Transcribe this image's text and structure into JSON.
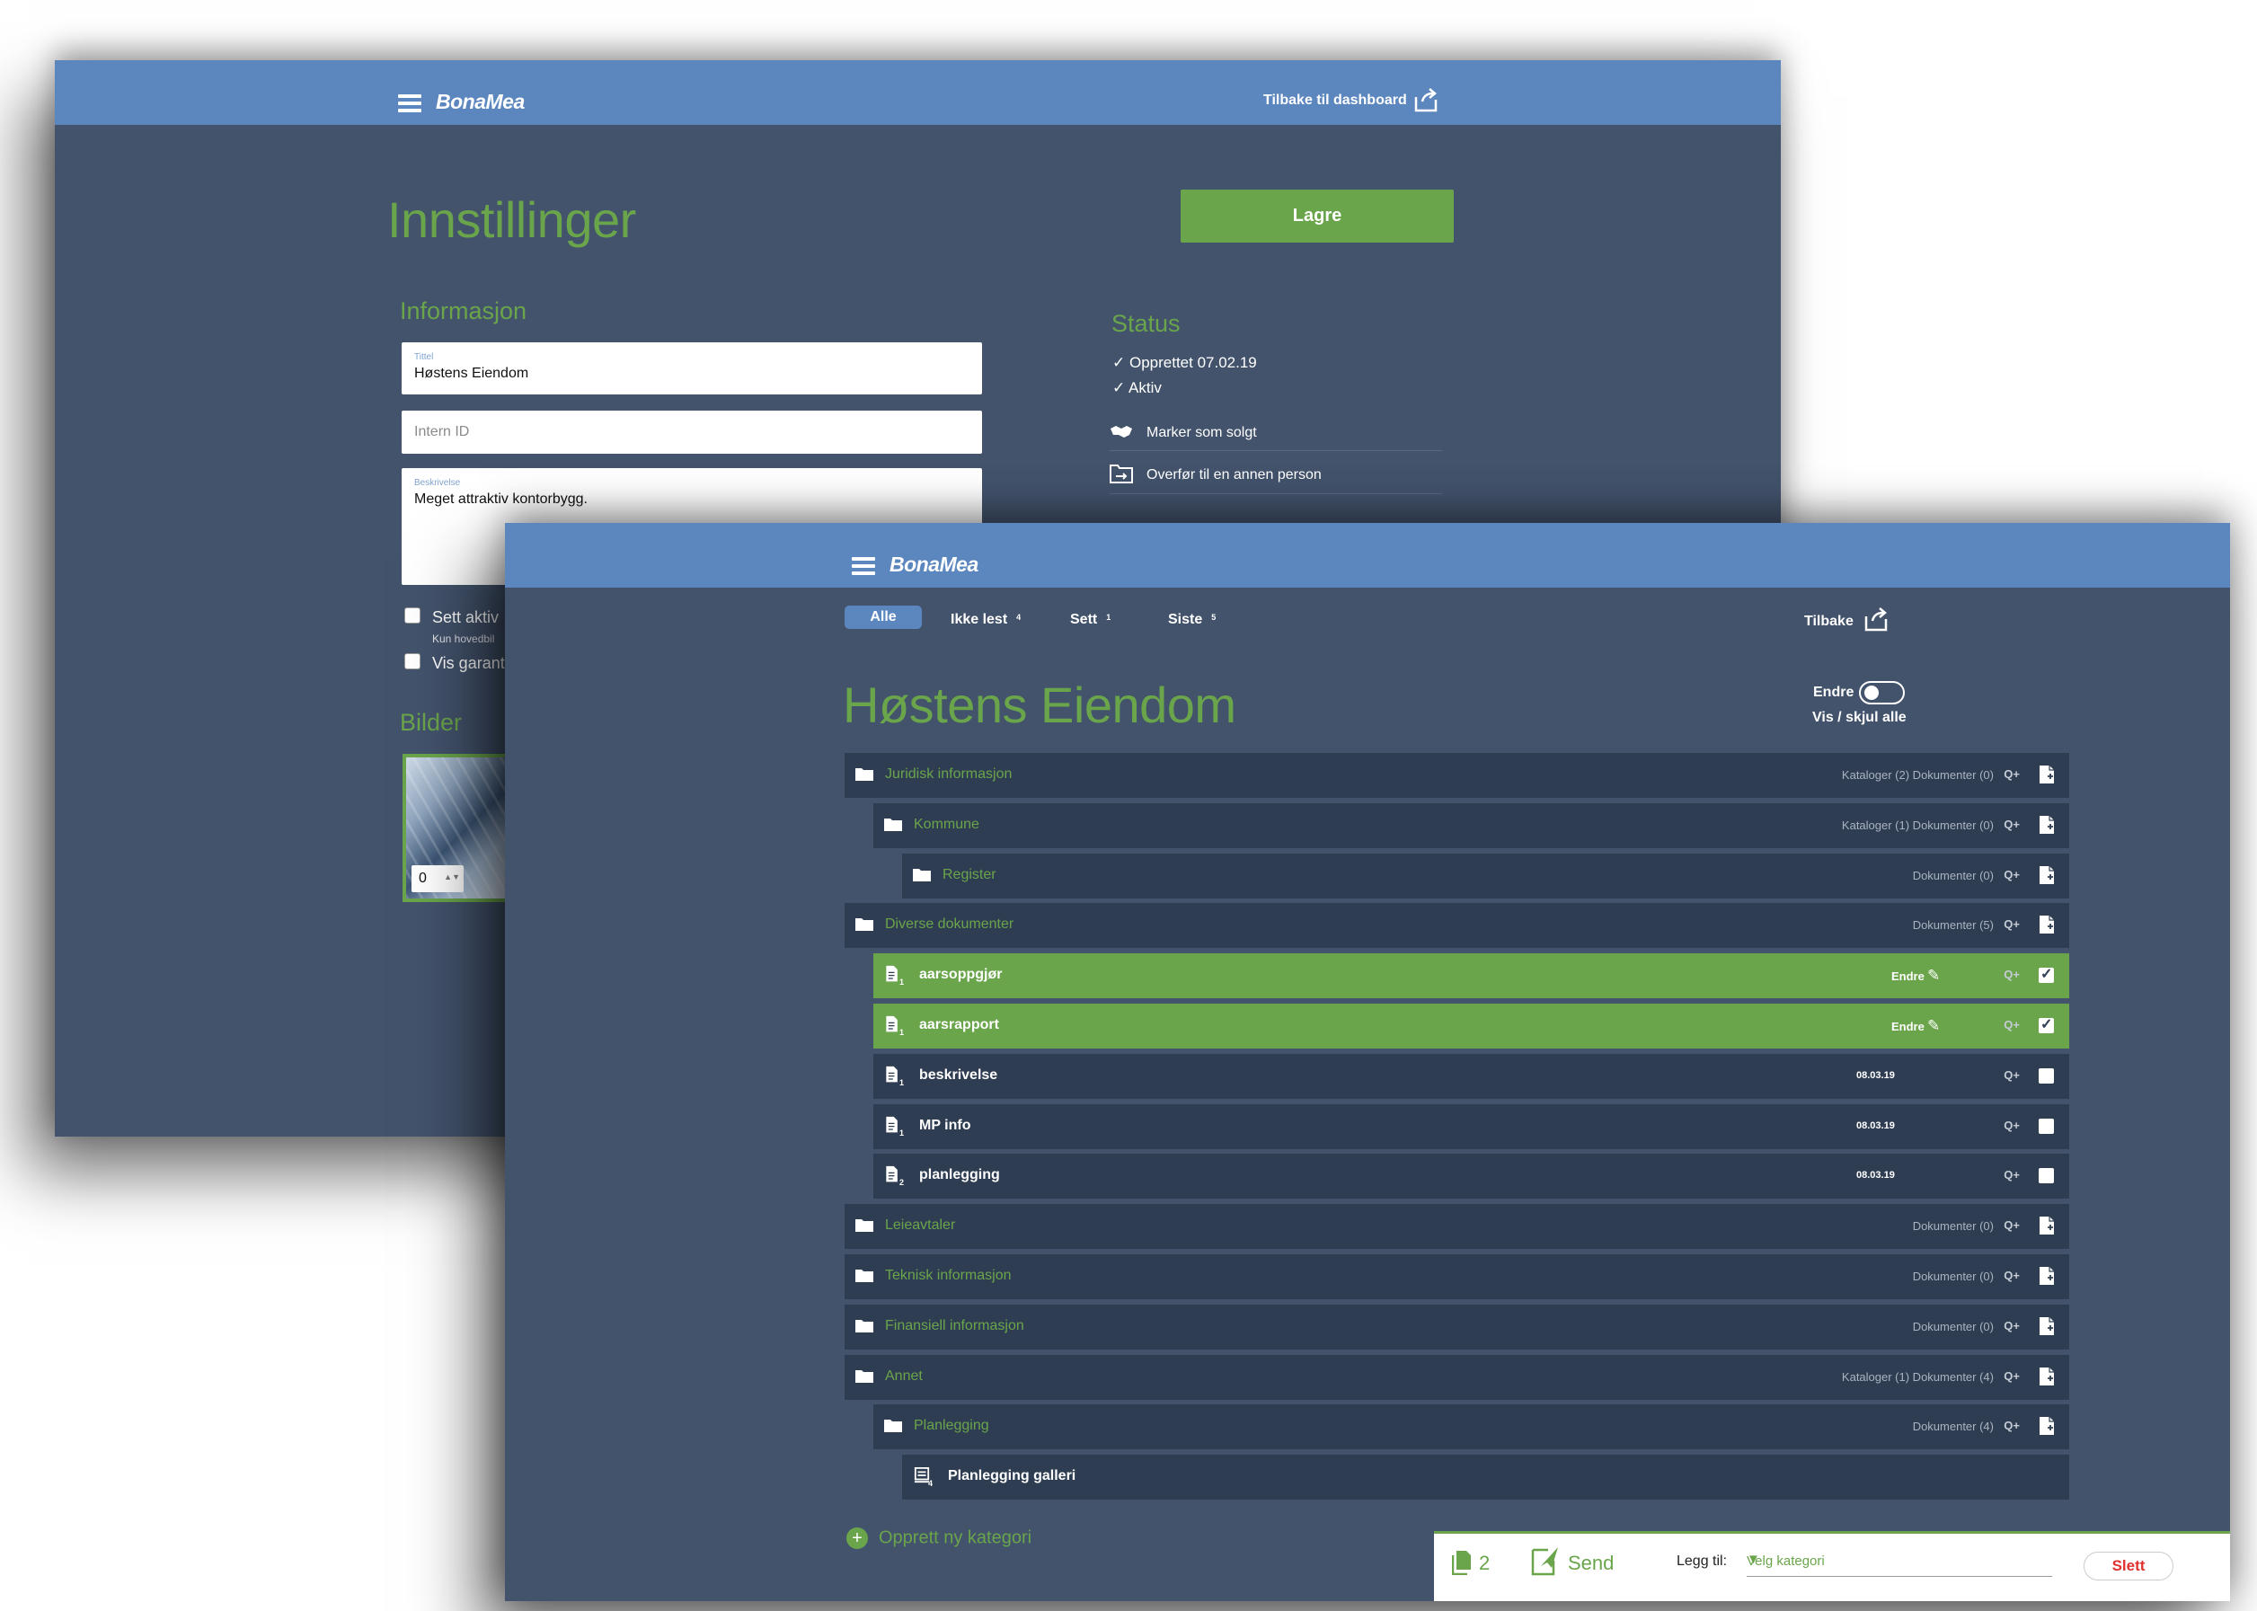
{
  "settings_window": {
    "logo": "BonaMea",
    "back_label": "Tilbake til dashboard",
    "title": "Innstillinger",
    "save_button": "Lagre",
    "info_heading": "Informasjon",
    "title_field": {
      "label": "Tittel",
      "value": "Høstens Eiendom"
    },
    "internal_id_field": {
      "placeholder": "Intern ID"
    },
    "description_field": {
      "label": "Beskrivelse",
      "value": "Meget attraktiv kontorbygg."
    },
    "checkbox_active": "Sett aktiv",
    "checkbox_active_note": "Kun hovedbil",
    "checkbox_guarantee": "Vis garant",
    "images_heading": "Bilder",
    "image_sort_value": "0",
    "status_heading": "Status",
    "status_items": [
      "✓ Opprettet 07.02.19",
      "✓ Aktiv"
    ],
    "actions": [
      "Marker som solgt",
      "Overfør til en annen person"
    ]
  },
  "documents_window": {
    "logo": "BonaMea",
    "tabs": [
      {
        "label": "Alle",
        "count": "",
        "active": true
      },
      {
        "label": "Ikke lest",
        "count": "4",
        "active": false
      },
      {
        "label": "Sett",
        "count": "1",
        "active": false
      },
      {
        "label": "Siste",
        "count": "5",
        "active": false
      }
    ],
    "back_label": "Tilbake",
    "title": "Høstens Eiendom",
    "edit_toggle_label": "Endre",
    "show_hide_all": "Vis / skjul alle",
    "add_icon_label": "Q+",
    "edit_label": "Endre",
    "rows": [
      {
        "type": "folder",
        "level": 0,
        "name": "Juridisk informasjon",
        "meta": "Kataloger (2) Dokumenter (0)"
      },
      {
        "type": "folder",
        "level": 1,
        "name": "Kommune",
        "meta": "Kataloger (1) Dokumenter (0)"
      },
      {
        "type": "folder",
        "level": 2,
        "name": "Register",
        "meta": "Dokumenter (0)"
      },
      {
        "type": "folder",
        "level": 0,
        "name": "Diverse dokumenter",
        "meta": "Dokumenter (5)"
      },
      {
        "type": "doc",
        "level": 1,
        "name": "aarsoppgjør",
        "badge": "1",
        "selected": true,
        "checked": true
      },
      {
        "type": "doc",
        "level": 1,
        "name": "aarsrapport",
        "badge": "1",
        "selected": true,
        "checked": true
      },
      {
        "type": "doc",
        "level": 1,
        "name": "beskrivelse",
        "badge": "1",
        "date": "08.03.19",
        "checked": false
      },
      {
        "type": "doc",
        "level": 1,
        "name": "MP info",
        "badge": "1",
        "date": "08.03.19",
        "checked": false
      },
      {
        "type": "doc",
        "level": 1,
        "name": "planlegging",
        "badge": "2",
        "date": "08.03.19",
        "checked": false
      },
      {
        "type": "folder",
        "level": 0,
        "name": "Leieavtaler",
        "meta": "Dokumenter (0)"
      },
      {
        "type": "folder",
        "level": 0,
        "name": "Teknisk informasjon",
        "meta": "Dokumenter (0)"
      },
      {
        "type": "folder",
        "level": 0,
        "name": "Finansiell informasjon",
        "meta": "Dokumenter (0)"
      },
      {
        "type": "folder",
        "level": 0,
        "name": "Annet",
        "meta": "Kataloger (1) Dokumenter (4)"
      },
      {
        "type": "folder",
        "level": 1,
        "name": "Planlegging",
        "meta": "Dokumenter (4)"
      },
      {
        "type": "gallery",
        "level": 2,
        "name": "Planlegging galleri",
        "badge": "4"
      }
    ],
    "add_category": "Opprett ny kategori",
    "footer": {
      "selected_count": "2",
      "send_label": "Send",
      "add_to_label": "Legg til:",
      "category_select": "Velg kategori",
      "delete_label": "Slett"
    }
  }
}
